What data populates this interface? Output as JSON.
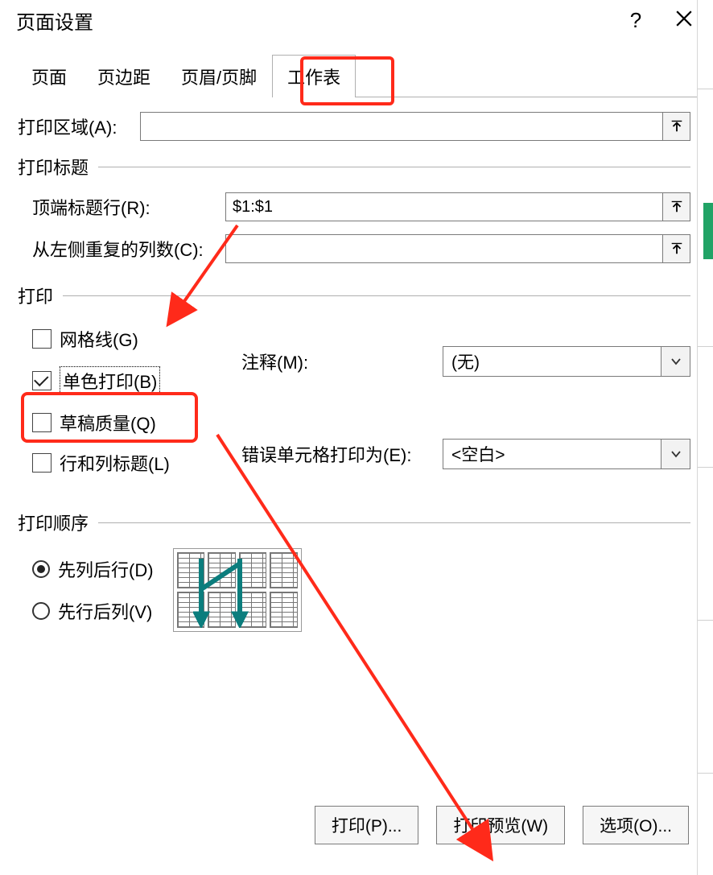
{
  "dialog": {
    "title": "页面设置",
    "help": "?",
    "close": "×"
  },
  "tabs": {
    "page": "页面",
    "margins": "页边距",
    "header_footer": "页眉/页脚",
    "sheet": "工作表"
  },
  "fields": {
    "print_area_label": "打印区域(A):",
    "print_area_value": "",
    "print_title_header": "打印标题",
    "title_rows_label": "顶端标题行(R):",
    "title_rows_value": "$1:$1",
    "title_cols_label": "从左侧重复的列数(C):",
    "title_cols_value": ""
  },
  "print_section": {
    "header": "打印",
    "gridlines": "网格线(G)",
    "black_white": "单色打印(B)",
    "draft": "草稿质量(Q)",
    "row_col_headings": "行和列标题(L)",
    "comments_label": "注释(M):",
    "comments_value": "(无)",
    "errors_label": "错误单元格打印为(E):",
    "errors_value": "<空白>"
  },
  "order_section": {
    "header": "打印顺序",
    "down_then_over": "先列后行(D)",
    "over_then_down": "先行后列(V)"
  },
  "buttons": {
    "print": "打印(P)...",
    "preview": "打印预览(W)",
    "options": "选项(O)..."
  }
}
